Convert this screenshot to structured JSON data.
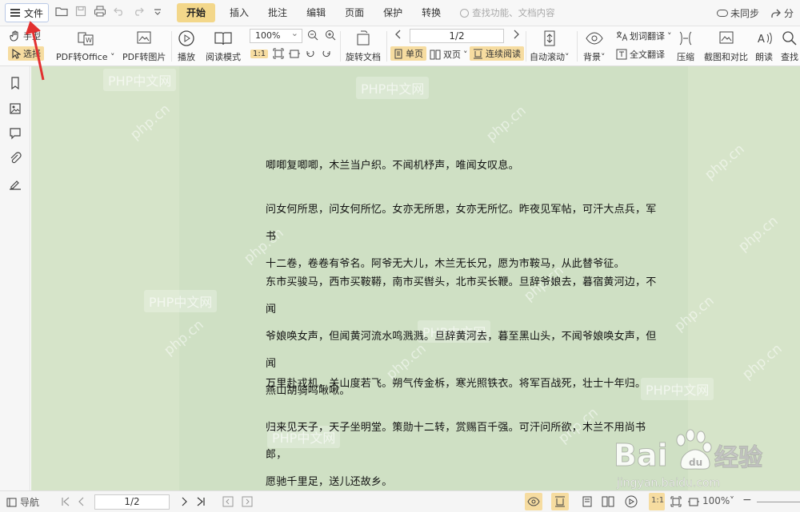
{
  "menubar": {
    "file_label": "文件",
    "tabs": [
      "开始",
      "插入",
      "批注",
      "编辑",
      "页面",
      "保护",
      "转换"
    ],
    "active_tab": "开始",
    "search_placeholder": "查找功能、文档内容",
    "sync_label": "未同步",
    "share_label": "分"
  },
  "ribbon": {
    "hand_label": "手型",
    "select_label": "选择",
    "pdf_to_office": "PDF转Office",
    "pdf_to_image": "PDF转图片",
    "play": "播放",
    "read_mode": "阅读模式",
    "zoom_value": "100%",
    "rotate_doc": "旋转文档",
    "page_value": "1/2",
    "single_page": "单页",
    "double_page": "双页",
    "continuous_read": "连续阅读",
    "auto_scroll": "自动滚动",
    "background": "背景",
    "word_translate": "划词翻译",
    "full_translate": "全文翻译",
    "compress": "压缩",
    "screenshot_compare": "截图和对比",
    "read_aloud": "朗读",
    "find": "查找"
  },
  "document": {
    "paragraphs": [
      [
        "唧唧复唧唧，木兰当户织。不闻机杼声，唯闻女叹息。"
      ],
      [
        "问女何所思，问女何所忆。女亦无所思，女亦无所忆。昨夜见军帖，可汗大点兵，军书",
        "十二卷，卷卷有爷名。阿爷无大儿，木兰无长兄，愿为市鞍马，从此替爷征。"
      ],
      [
        "东市买骏马，西市买鞍鞯，南市买辔头，北市买长鞭。旦辞爷娘去，暮宿黄河边，不闻",
        "爷娘唤女声，但闻黄河流水鸣溅溅。旦辞黄河去，暮至黑山头，不闻爷娘唤女声，但闻",
        "燕山胡骑鸣啾啾。"
      ],
      [
        "万里赴戎机，关山度若飞。朔气传金柝，寒光照铁衣。将军百战死，壮士十年归。"
      ],
      [
        "归来见天子，天子坐明堂。策勋十二转，赏赐百千强。可汗问所欲，木兰不用尚书郎，",
        "愿驰千里足，送儿还故乡。"
      ]
    ],
    "watermark_text": "PHP中文网",
    "watermark_rotated": "php.cn"
  },
  "statusbar": {
    "nav_label": "导航",
    "page_value": "1/2",
    "zoom_value": "100%"
  },
  "baidu": {
    "brand": "Bai",
    "brand2": "经验",
    "url": "jingyan.baidu.com"
  },
  "colors": {
    "doc_bg": "#d6e4c9",
    "page_bg": "#cfe0c4",
    "accent": "#f3d78a",
    "arrow": "#e23030"
  }
}
